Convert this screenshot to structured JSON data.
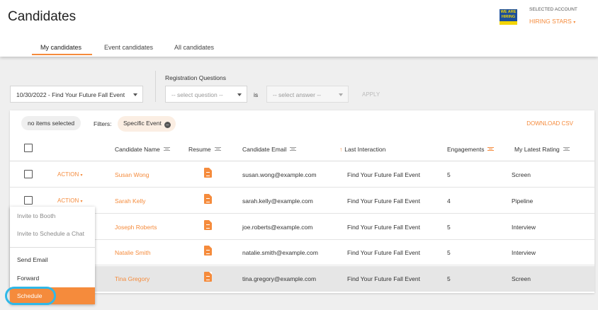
{
  "header": {
    "title": "Candidates",
    "logo_text": "WE ARE HIRING",
    "account_label": "SELECTED ACCOUNT",
    "account_name": "HIRING STARS",
    "tabs": [
      "My candidates",
      "Event candidates",
      "All candidates"
    ]
  },
  "filters": {
    "event_value": "10/30/2022 - Find Your Future Fall Event",
    "registration_label": "Registration Questions",
    "question_placeholder": "-- select question --",
    "is_label": "is",
    "answer_placeholder": "-- select answer --",
    "apply_label": "APPLY"
  },
  "toolbar": {
    "selection_text": "no items selected",
    "filters_label": "Filters:",
    "active_filter": "Specific Event",
    "download_label": "DOWNLOAD CSV"
  },
  "table": {
    "columns": [
      "Candidate Name",
      "Resume",
      "Candidate Email",
      "Last Interaction",
      "Engagements",
      "My Latest Rating"
    ],
    "action_label": "ACTION",
    "rows": [
      {
        "name": "Susan Wong",
        "email": "susan.wong@example.com",
        "last_interaction": "Find Your Future Fall Event",
        "engagements": "5",
        "rating": "Screen"
      },
      {
        "name": "Sarah Kelly",
        "email": "sarah.kelly@example.com",
        "last_interaction": "Find Your Future Fall Event",
        "engagements": "4",
        "rating": "Pipeline"
      },
      {
        "name": "Joseph Roberts",
        "email": "joe.roberts@example.com",
        "last_interaction": "Find Your Future Fall Event",
        "engagements": "5",
        "rating": "Interview"
      },
      {
        "name": "Natalie Smith",
        "email": "natalie.smith@example.com",
        "last_interaction": "Find Your Future Fall Event",
        "engagements": "5",
        "rating": "Interview"
      },
      {
        "name": "Tina Gregory",
        "email": "tina.gregory@example.com",
        "last_interaction": "Find Your Future Fall Event",
        "engagements": "5",
        "rating": "Screen"
      }
    ]
  },
  "action_menu": {
    "items": [
      "Invite to Booth",
      "Invite to Schedule a Chat",
      "Send Email",
      "Forward",
      "Schedule"
    ]
  },
  "colors": {
    "accent": "#f58b3c",
    "highlight_ring": "#2fb8e8"
  }
}
